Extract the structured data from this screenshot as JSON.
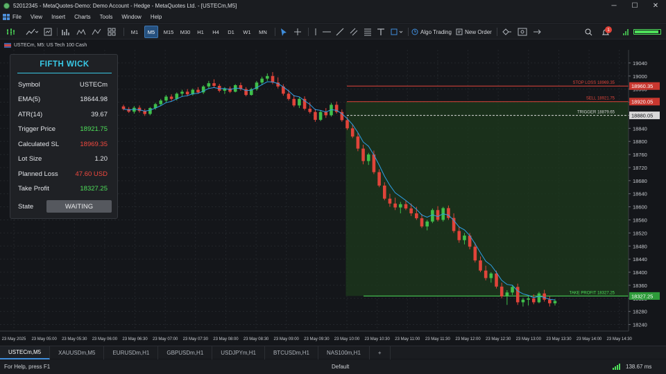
{
  "window": {
    "title": "52012345 - MetaQuotes-Demo: Demo Account - Hedge - MetaQuotes Ltd. - [USTECm,M5]",
    "minimize": "─",
    "maximize": "☐",
    "close": "✕"
  },
  "menu": [
    "File",
    "View",
    "Insert",
    "Charts",
    "Tools",
    "Window",
    "Help"
  ],
  "toolbar": {
    "timeframes": [
      "M1",
      "M5",
      "M15",
      "M30",
      "H1",
      "H4",
      "D1",
      "W1",
      "MN"
    ],
    "active_timeframe": "M5",
    "algo_trading": "Algo Trading",
    "new_order": "New Order",
    "notification_count": "1"
  },
  "symbol_header": "USTECm, M5:  US Tech 100 Cash",
  "panel": {
    "title": "FIFTH WICK",
    "rows": [
      {
        "label": "Symbol",
        "value": "USTECm",
        "tone": "white"
      },
      {
        "label": "EMA(5)",
        "value": "18644.98",
        "tone": "white"
      },
      {
        "label": "ATR(14)",
        "value": "39.67",
        "tone": "white"
      },
      {
        "label": "Trigger Price",
        "value": "18921.75",
        "tone": "green"
      },
      {
        "label": "Calculated SL",
        "value": "18969.35",
        "tone": "red"
      },
      {
        "label": "Lot Size",
        "value": "1.20",
        "tone": "white"
      },
      {
        "label": "Planned Loss",
        "value": "47.60 USD",
        "tone": "red"
      },
      {
        "label": "Take Profit",
        "value": "18327.25",
        "tone": "green"
      }
    ],
    "state_label": "State",
    "state_value": "WAITING"
  },
  "chart_data": {
    "type": "candlestick",
    "symbol": "USTECm",
    "timeframe": "M5",
    "ylim": [
      18220,
      19080
    ],
    "y_ticks": [
      19040,
      19000,
      18960,
      18920,
      18880,
      18840,
      18800,
      18760,
      18720,
      18680,
      18640,
      18600,
      18560,
      18520,
      18480,
      18440,
      18400,
      18360,
      18320,
      18280,
      18240
    ],
    "x_tick_labels": [
      "23 May 2025",
      "23 May 05:00",
      "23 May 05:30",
      "23 May 06:00",
      "23 May 06:30",
      "23 May 07:00",
      "23 May 07:30",
      "23 May 08:00",
      "23 May 08:30",
      "23 May 09:00",
      "23 May 09:30",
      "23 May 10:00",
      "23 May 10:30",
      "23 May 11:00",
      "23 May 11:30",
      "23 May 12:00",
      "23 May 12:30",
      "23 May 13:00",
      "23 May 13:30",
      "23 May 14:00",
      "23 May 14:30"
    ],
    "levels": [
      {
        "name": "STOP LOSS 18969.35",
        "price": 18969.35,
        "color": "#e0443a",
        "style": "solid",
        "tag": "18960.35"
      },
      {
        "name": "SELL 18921.75",
        "price": 18921.75,
        "color": "#e0443a",
        "style": "solid",
        "tag": "18920.05"
      },
      {
        "name": "TRIGGER 18879.65",
        "price": 18879.65,
        "color": "#d8d8d8",
        "style": "dashed",
        "tag": "18880.05"
      },
      {
        "name": "TAKE PROFIT 18327.25",
        "price": 18327.25,
        "color": "#4ee05a",
        "style": "solid",
        "tag": "18327.25"
      }
    ],
    "candles": [
      [
        18907,
        18912,
        18895,
        18899
      ],
      [
        18899,
        18905,
        18887,
        18891
      ],
      [
        18891,
        18908,
        18885,
        18903
      ],
      [
        18903,
        18910,
        18888,
        18893
      ],
      [
        18893,
        18900,
        18878,
        18884
      ],
      [
        18884,
        18905,
        18880,
        18902
      ],
      [
        18902,
        18918,
        18897,
        18914
      ],
      [
        18914,
        18930,
        18908,
        18925
      ],
      [
        18925,
        18942,
        18918,
        18937
      ],
      [
        18937,
        18944,
        18924,
        18930
      ],
      [
        18930,
        18950,
        18925,
        18946
      ],
      [
        18946,
        18958,
        18938,
        18952
      ],
      [
        18952,
        18960,
        18938,
        18944
      ],
      [
        18944,
        18962,
        18940,
        18958
      ],
      [
        18958,
        18966,
        18946,
        18950
      ],
      [
        18950,
        18972,
        18945,
        18968
      ],
      [
        18968,
        18985,
        18962,
        18978
      ],
      [
        18978,
        18990,
        18965,
        18970
      ],
      [
        18970,
        18976,
        18950,
        18955
      ],
      [
        18955,
        18966,
        18945,
        18962
      ],
      [
        18962,
        18968,
        18948,
        18952
      ],
      [
        18952,
        18975,
        18950,
        18972
      ],
      [
        18972,
        18980,
        18955,
        18960
      ],
      [
        18960,
        18966,
        18938,
        18942
      ],
      [
        18942,
        18964,
        18940,
        18960
      ],
      [
        18960,
        18985,
        18955,
        18980
      ],
      [
        18980,
        18998,
        18972,
        18992
      ],
      [
        18992,
        19008,
        18985,
        19000
      ],
      [
        19000,
        19012,
        18975,
        18980
      ],
      [
        18980,
        18996,
        18962,
        18968
      ],
      [
        18968,
        18975,
        18940,
        18946
      ],
      [
        18946,
        18958,
        18925,
        18930
      ],
      [
        18930,
        18942,
        18905,
        18910
      ],
      [
        18910,
        18935,
        18902,
        18930
      ],
      [
        18930,
        18938,
        18895,
        18900
      ],
      [
        18900,
        18920,
        18885,
        18890
      ],
      [
        18890,
        18900,
        18860,
        18866
      ],
      [
        18866,
        18895,
        18862,
        18890
      ],
      [
        18890,
        18902,
        18872,
        18880
      ],
      [
        18880,
        18918,
        18876,
        18912
      ],
      [
        18912,
        18922,
        18885,
        18890
      ],
      [
        18890,
        18898,
        18860,
        18865
      ],
      [
        18865,
        18875,
        18835,
        18840
      ],
      [
        18840,
        18852,
        18810,
        18815
      ],
      [
        18815,
        18826,
        18770,
        18778
      ],
      [
        18778,
        18790,
        18730,
        18740
      ],
      [
        18740,
        18765,
        18728,
        18760
      ],
      [
        18760,
        18772,
        18700,
        18706
      ],
      [
        18706,
        18715,
        18660,
        18665
      ],
      [
        18665,
        18675,
        18620,
        18625
      ],
      [
        18625,
        18640,
        18600,
        18610
      ],
      [
        18610,
        18628,
        18590,
        18598
      ],
      [
        18598,
        18615,
        18580,
        18608
      ],
      [
        18608,
        18620,
        18590,
        18595
      ],
      [
        18595,
        18610,
        18572,
        18580
      ],
      [
        18580,
        18600,
        18560,
        18565
      ],
      [
        18565,
        18578,
        18535,
        18540
      ],
      [
        18540,
        18560,
        18528,
        18555
      ],
      [
        18555,
        18595,
        18550,
        18590
      ],
      [
        18590,
        18602,
        18555,
        18560
      ],
      [
        18560,
        18600,
        18555,
        18596
      ],
      [
        18596,
        18604,
        18560,
        18566
      ],
      [
        18566,
        18580,
        18520,
        18526
      ],
      [
        18526,
        18540,
        18490,
        18498
      ],
      [
        18498,
        18520,
        18485,
        18512
      ],
      [
        18512,
        18520,
        18470,
        18478
      ],
      [
        18478,
        18490,
        18430,
        18436
      ],
      [
        18436,
        18448,
        18400,
        18405
      ],
      [
        18405,
        18420,
        18375,
        18382
      ],
      [
        18382,
        18400,
        18368,
        18396
      ],
      [
        18396,
        18405,
        18350,
        18356
      ],
      [
        18356,
        18368,
        18320,
        18326
      ],
      [
        18326,
        18345,
        18300,
        18338
      ],
      [
        18338,
        18360,
        18330,
        18355
      ],
      [
        18355,
        18365,
        18300,
        18308
      ],
      [
        18308,
        18322,
        18295,
        18316
      ],
      [
        18316,
        18328,
        18298,
        18320
      ],
      [
        18320,
        18332,
        18302,
        18308
      ],
      [
        18308,
        18340,
        18305,
        18335
      ],
      [
        18335,
        18346,
        18310,
        18316
      ],
      [
        18316,
        18326,
        18295,
        18305
      ],
      [
        18305,
        18318,
        18298,
        18312
      ]
    ]
  },
  "tabs": [
    "USTECm,M5",
    "XAUUSDm,M5",
    "EURUSDm,H1",
    "GBPUSDm,H1",
    "USDJPYm,H1",
    "BTCUSDm,H1",
    "NAS100m,H1",
    "+"
  ],
  "status": {
    "help": "For Help, press F1",
    "profile": "Default",
    "ping": "138.67 ms"
  },
  "colors": {
    "bull": "#3fbf4a",
    "bear": "#e0443a",
    "ema": "#2f9fe6",
    "tp_zone": "#1c3a1c",
    "accent": "#39c9e6"
  }
}
